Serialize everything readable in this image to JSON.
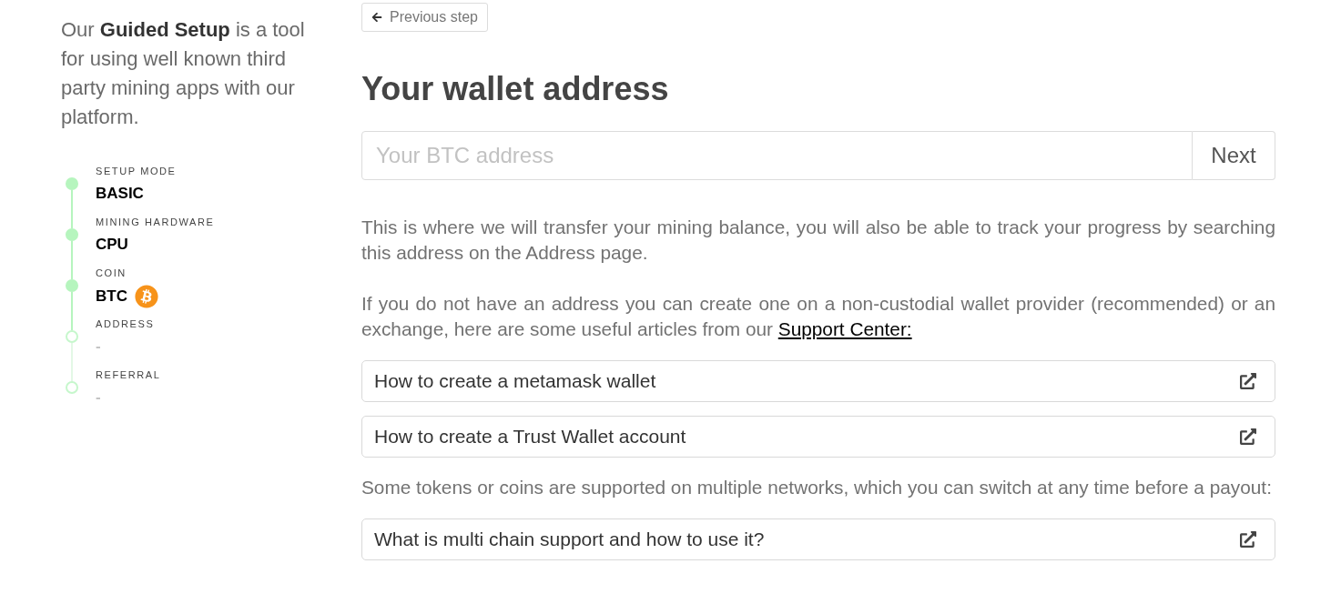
{
  "sidebar": {
    "intro": "Our **Guided Setup** is a tool for using well known third party mining apps with our platform.",
    "steps": [
      {
        "label": "SETUP MODE",
        "value": "BASIC",
        "kind": "text",
        "completed": true
      },
      {
        "label": "MINING HARDWARE",
        "value": "CPU",
        "kind": "text",
        "completed": true
      },
      {
        "label": "COIN",
        "value": "BTC",
        "kind": "coin",
        "completed": true
      },
      {
        "label": "ADDRESS",
        "value": "-",
        "kind": "text",
        "completed": false
      },
      {
        "label": "REFERRAL",
        "value": "-",
        "kind": "text",
        "completed": false
      }
    ]
  },
  "main": {
    "back_button": "Previous step",
    "heading": "Your wallet address",
    "address_field": {
      "placeholder": "Your BTC address"
    },
    "next_button": "Next",
    "content": [
      {
        "kind": "paragraph",
        "text": "This is where we will transfer your mining balance, you will also be able to track your progress by searching this address on the Address page."
      },
      {
        "kind": "paragraph",
        "text": "If you do not have an address you can create one on a non-custodial wallet provider (recommended) or an exchange, here are some useful articles from our",
        "link": "Support Center:"
      },
      {
        "kind": "article_link",
        "title": "How to create a metamask wallet"
      },
      {
        "kind": "article_link",
        "title": "How to create a Trust Wallet account"
      },
      {
        "kind": "paragraph",
        "text": "Some tokens or coins are supported on multiple networks, which you can switch at any time before a payout:"
      },
      {
        "kind": "article_link",
        "title": "What is multi chain support and how to use it?"
      }
    ]
  }
}
